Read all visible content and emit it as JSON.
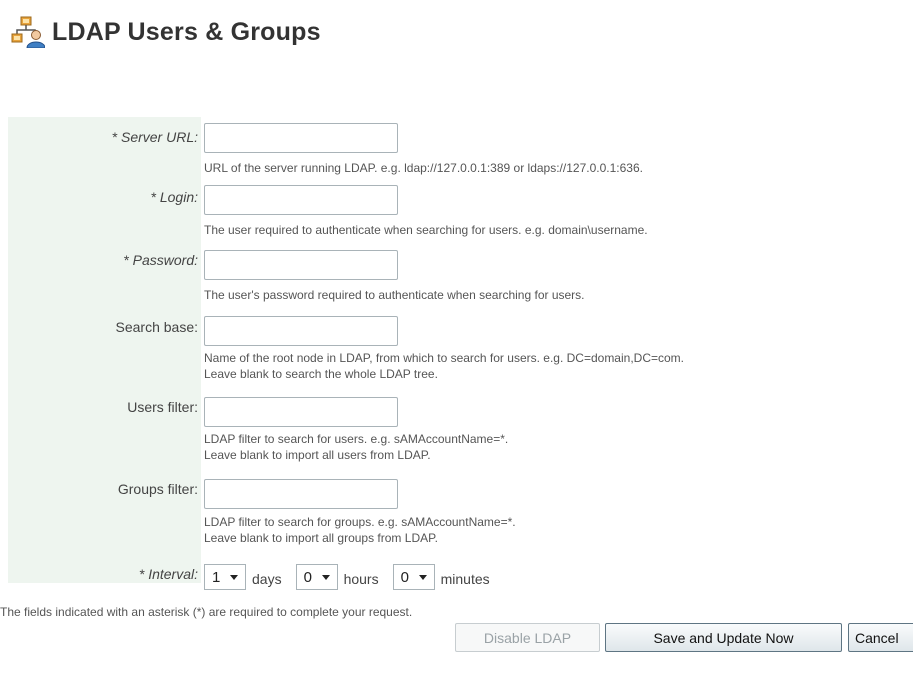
{
  "header": {
    "title": "LDAP Users & Groups",
    "icon": "users-network-icon"
  },
  "form": {
    "fields": [
      {
        "label": "* Server URL:",
        "value": "",
        "help": [
          "URL of the server running LDAP. e.g. ldap://127.0.0.1:389 or ldaps://127.0.0.1:636."
        ]
      },
      {
        "label": "* Login:",
        "value": "",
        "help": [
          "The user required to authenticate when searching for users. e.g. domain\\username."
        ]
      },
      {
        "label": "* Password:",
        "value": "",
        "help": [
          "The user's password required to authenticate when searching for users."
        ]
      },
      {
        "label": "Search base:",
        "value": "",
        "help": [
          "Name of the root node in LDAP, from which to search for users. e.g. DC=domain,DC=com.",
          "Leave blank to search the whole LDAP tree."
        ]
      },
      {
        "label": "Users filter:",
        "value": "",
        "help": [
          "LDAP filter to search for users. e.g. sAMAccountName=*.",
          "Leave blank to import all users from LDAP."
        ]
      },
      {
        "label": "Groups filter:",
        "value": "",
        "help": [
          "LDAP filter to search for groups. e.g. sAMAccountName=*.",
          "Leave blank to import all groups from LDAP."
        ]
      }
    ],
    "interval": {
      "label": "* Interval:",
      "days_value": "1",
      "days_unit": "days",
      "hours_value": "0",
      "hours_unit": "hours",
      "minutes_value": "0",
      "minutes_unit": "minutes"
    }
  },
  "required_note": "The fields indicated with an asterisk (*) are required to complete your request.",
  "buttons": {
    "disable": "Disable LDAP",
    "save": "Save and Update Now",
    "cancel": "Cancel"
  },
  "colors": {
    "label_column_bg": "#eef5ef",
    "icon_orange": "#e8a33b",
    "icon_blue": "#3f7fc4"
  }
}
